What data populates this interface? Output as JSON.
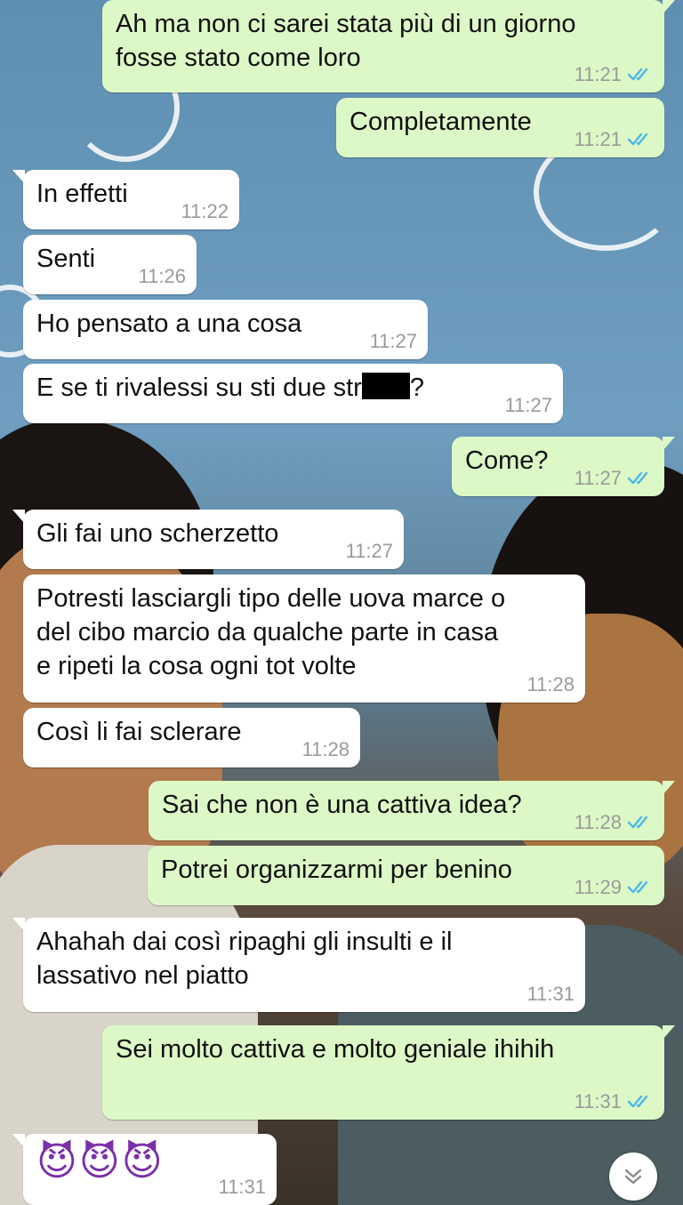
{
  "chat": {
    "messages": [
      {
        "dir": "out",
        "text": "Ah ma non ci sarei stata più di un giorno\nfosse stato come loro",
        "time": "11:21",
        "read": true
      },
      {
        "dir": "out",
        "text": "Completamente",
        "time": "11:21",
        "read": true
      },
      {
        "dir": "in",
        "text": "In effetti",
        "time": "11:22"
      },
      {
        "dir": "in",
        "text": "Senti",
        "time": "11:26"
      },
      {
        "dir": "in",
        "text": "Ho pensato a una cosa",
        "time": "11:27"
      },
      {
        "dir": "in",
        "text_before": "E se ti rivalessi su sti due str",
        "text_after": "?",
        "time": "11:27"
      },
      {
        "dir": "out",
        "text": "Come?",
        "time": "11:27",
        "read": true
      },
      {
        "dir": "in",
        "text": "Gli fai uno scherzetto",
        "time": "11:27"
      },
      {
        "dir": "in",
        "text": "Potresti lasciargli tipo delle uova marce o\ndel cibo marcio da qualche parte in casa\ne ripeti la cosa ogni tot volte",
        "time": "11:28"
      },
      {
        "dir": "in",
        "text": "Così li fai sclerare",
        "time": "11:28"
      },
      {
        "dir": "out",
        "text": "Sai che non è una cattiva idea?",
        "time": "11:28",
        "read": true
      },
      {
        "dir": "out",
        "text": "Potrei organizzarmi per benino",
        "time": "11:29",
        "read": true
      },
      {
        "dir": "in",
        "text": "Ahahah dai così ripaghi gli insulti e il\nlassativo nel piatto",
        "time": "11:31"
      },
      {
        "dir": "out",
        "text": "Sei molto cattiva e molto geniale ihihih",
        "time": "11:31",
        "read": true
      },
      {
        "dir": "in",
        "text": "😈😈😈",
        "time": "11:31"
      }
    ]
  },
  "colors": {
    "incoming_bubble": "#ffffff",
    "outgoing_bubble": "#dcf8c6",
    "read_check": "#4fb6ec",
    "timestamp": "#9a9a9a"
  },
  "icons": {
    "read_receipt": "double-check-icon",
    "scroll_down": "double-chevron-down-icon"
  }
}
